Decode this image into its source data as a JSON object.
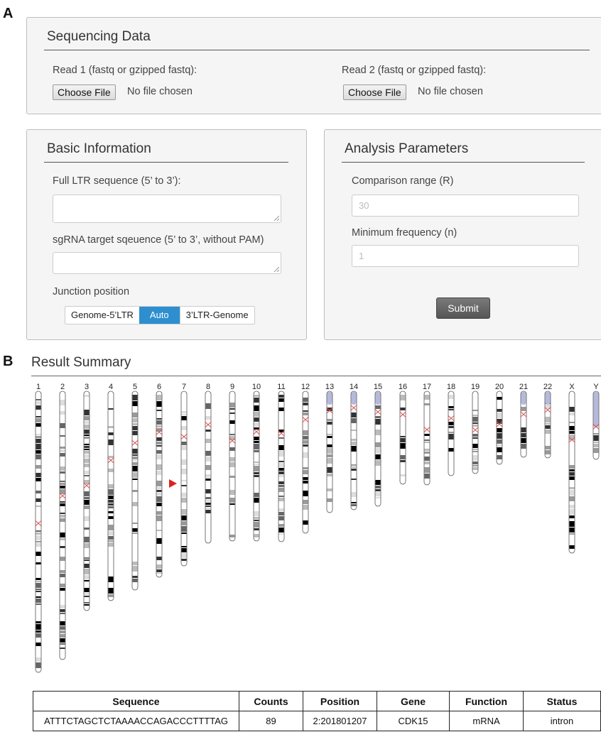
{
  "panel_labels": {
    "a": "A",
    "b": "B"
  },
  "sequencing": {
    "title": "Sequencing Data",
    "read1_label": "Read 1 (fastq or gzipped fastq):",
    "read2_label": "Read 2 (fastq or gzipped fastq):",
    "choose_file": "Choose File",
    "no_file": "No file chosen"
  },
  "basic": {
    "title": "Basic Information",
    "ltr_label": "Full LTR sequence (5’ to 3’):",
    "sgrna_label": "sgRNA target sqeuence (5’ to 3’, without PAM)",
    "junction_label": "Junction position",
    "junction_options": [
      "Genome-5’LTR",
      "Auto",
      "3’LTR-Genome"
    ],
    "junction_selected": "Auto"
  },
  "analysis": {
    "title": "Analysis Parameters",
    "range_label": "Comparison range (R)",
    "range_value": "30",
    "freq_label": "Minimum frequency (n)",
    "freq_value": "1",
    "submit": "Submit"
  },
  "result": {
    "title": "Result Summary",
    "chromosomes": [
      "1",
      "2",
      "3",
      "4",
      "5",
      "6",
      "7",
      "8",
      "9",
      "10",
      "11",
      "12",
      "13",
      "14",
      "15",
      "16",
      "17",
      "18",
      "19",
      "20",
      "21",
      "22",
      "X",
      "Y"
    ],
    "marker_chromosome": "7",
    "table": {
      "headers": [
        "Sequence",
        "Counts",
        "Position",
        "Gene",
        "Function",
        "Status"
      ],
      "rows": [
        [
          "ATTTCTAGCTCTAAAACCAGACCCTTTTAG",
          "89",
          "2:201801207",
          "CDK15",
          "mRNA",
          "intron"
        ]
      ]
    }
  },
  "colors": {
    "accent": "#2d8fcf",
    "marker": "#e02020",
    "centromere": "#d9534f",
    "heterochromatin": "#b6b9dd"
  }
}
